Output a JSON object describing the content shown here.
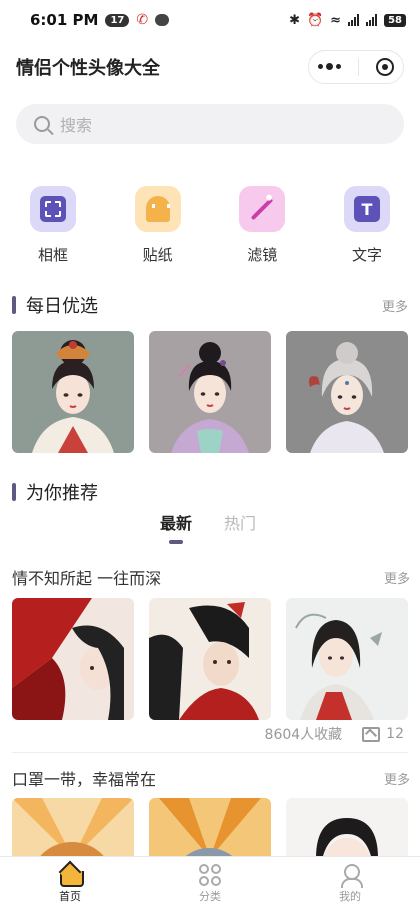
{
  "status_bar": {
    "time": "6:01 PM",
    "notification_count": "17",
    "battery": "58"
  },
  "header": {
    "title": "情侣个性头像大全"
  },
  "search": {
    "placeholder": "搜索"
  },
  "tools": [
    {
      "label": "相框",
      "icon": "photo-frame-icon",
      "color": "#dcd8f7"
    },
    {
      "label": "贴纸",
      "icon": "sticker-ghost-icon",
      "color": "#fde3b6"
    },
    {
      "label": "滤镜",
      "icon": "magic-wand-icon",
      "color": "#f7c9ec"
    },
    {
      "label": "文字",
      "icon": "text-icon",
      "color": "#dcd8f7",
      "glyph": "T"
    }
  ],
  "daily_pick": {
    "title": "每日优选",
    "more": "更多"
  },
  "recommend": {
    "title": "为你推荐",
    "tabs": [
      {
        "label": "最新",
        "active": true
      },
      {
        "label": "热门",
        "active": false
      }
    ]
  },
  "collections": [
    {
      "title": "情不知所起 一往而深",
      "more": "更多",
      "favorites": "8604人收藏",
      "image_count": "12"
    },
    {
      "title": "口罩一带，幸福常在",
      "more": "更多"
    }
  ],
  "tabbar": [
    {
      "label": "首页",
      "icon": "home-icon",
      "active": true
    },
    {
      "label": "分类",
      "icon": "category-grid-icon",
      "active": false
    },
    {
      "label": "我的",
      "icon": "profile-icon",
      "active": false
    }
  ],
  "colors": {
    "accent": "#5c5a82",
    "home_icon": "#f4b63a"
  }
}
